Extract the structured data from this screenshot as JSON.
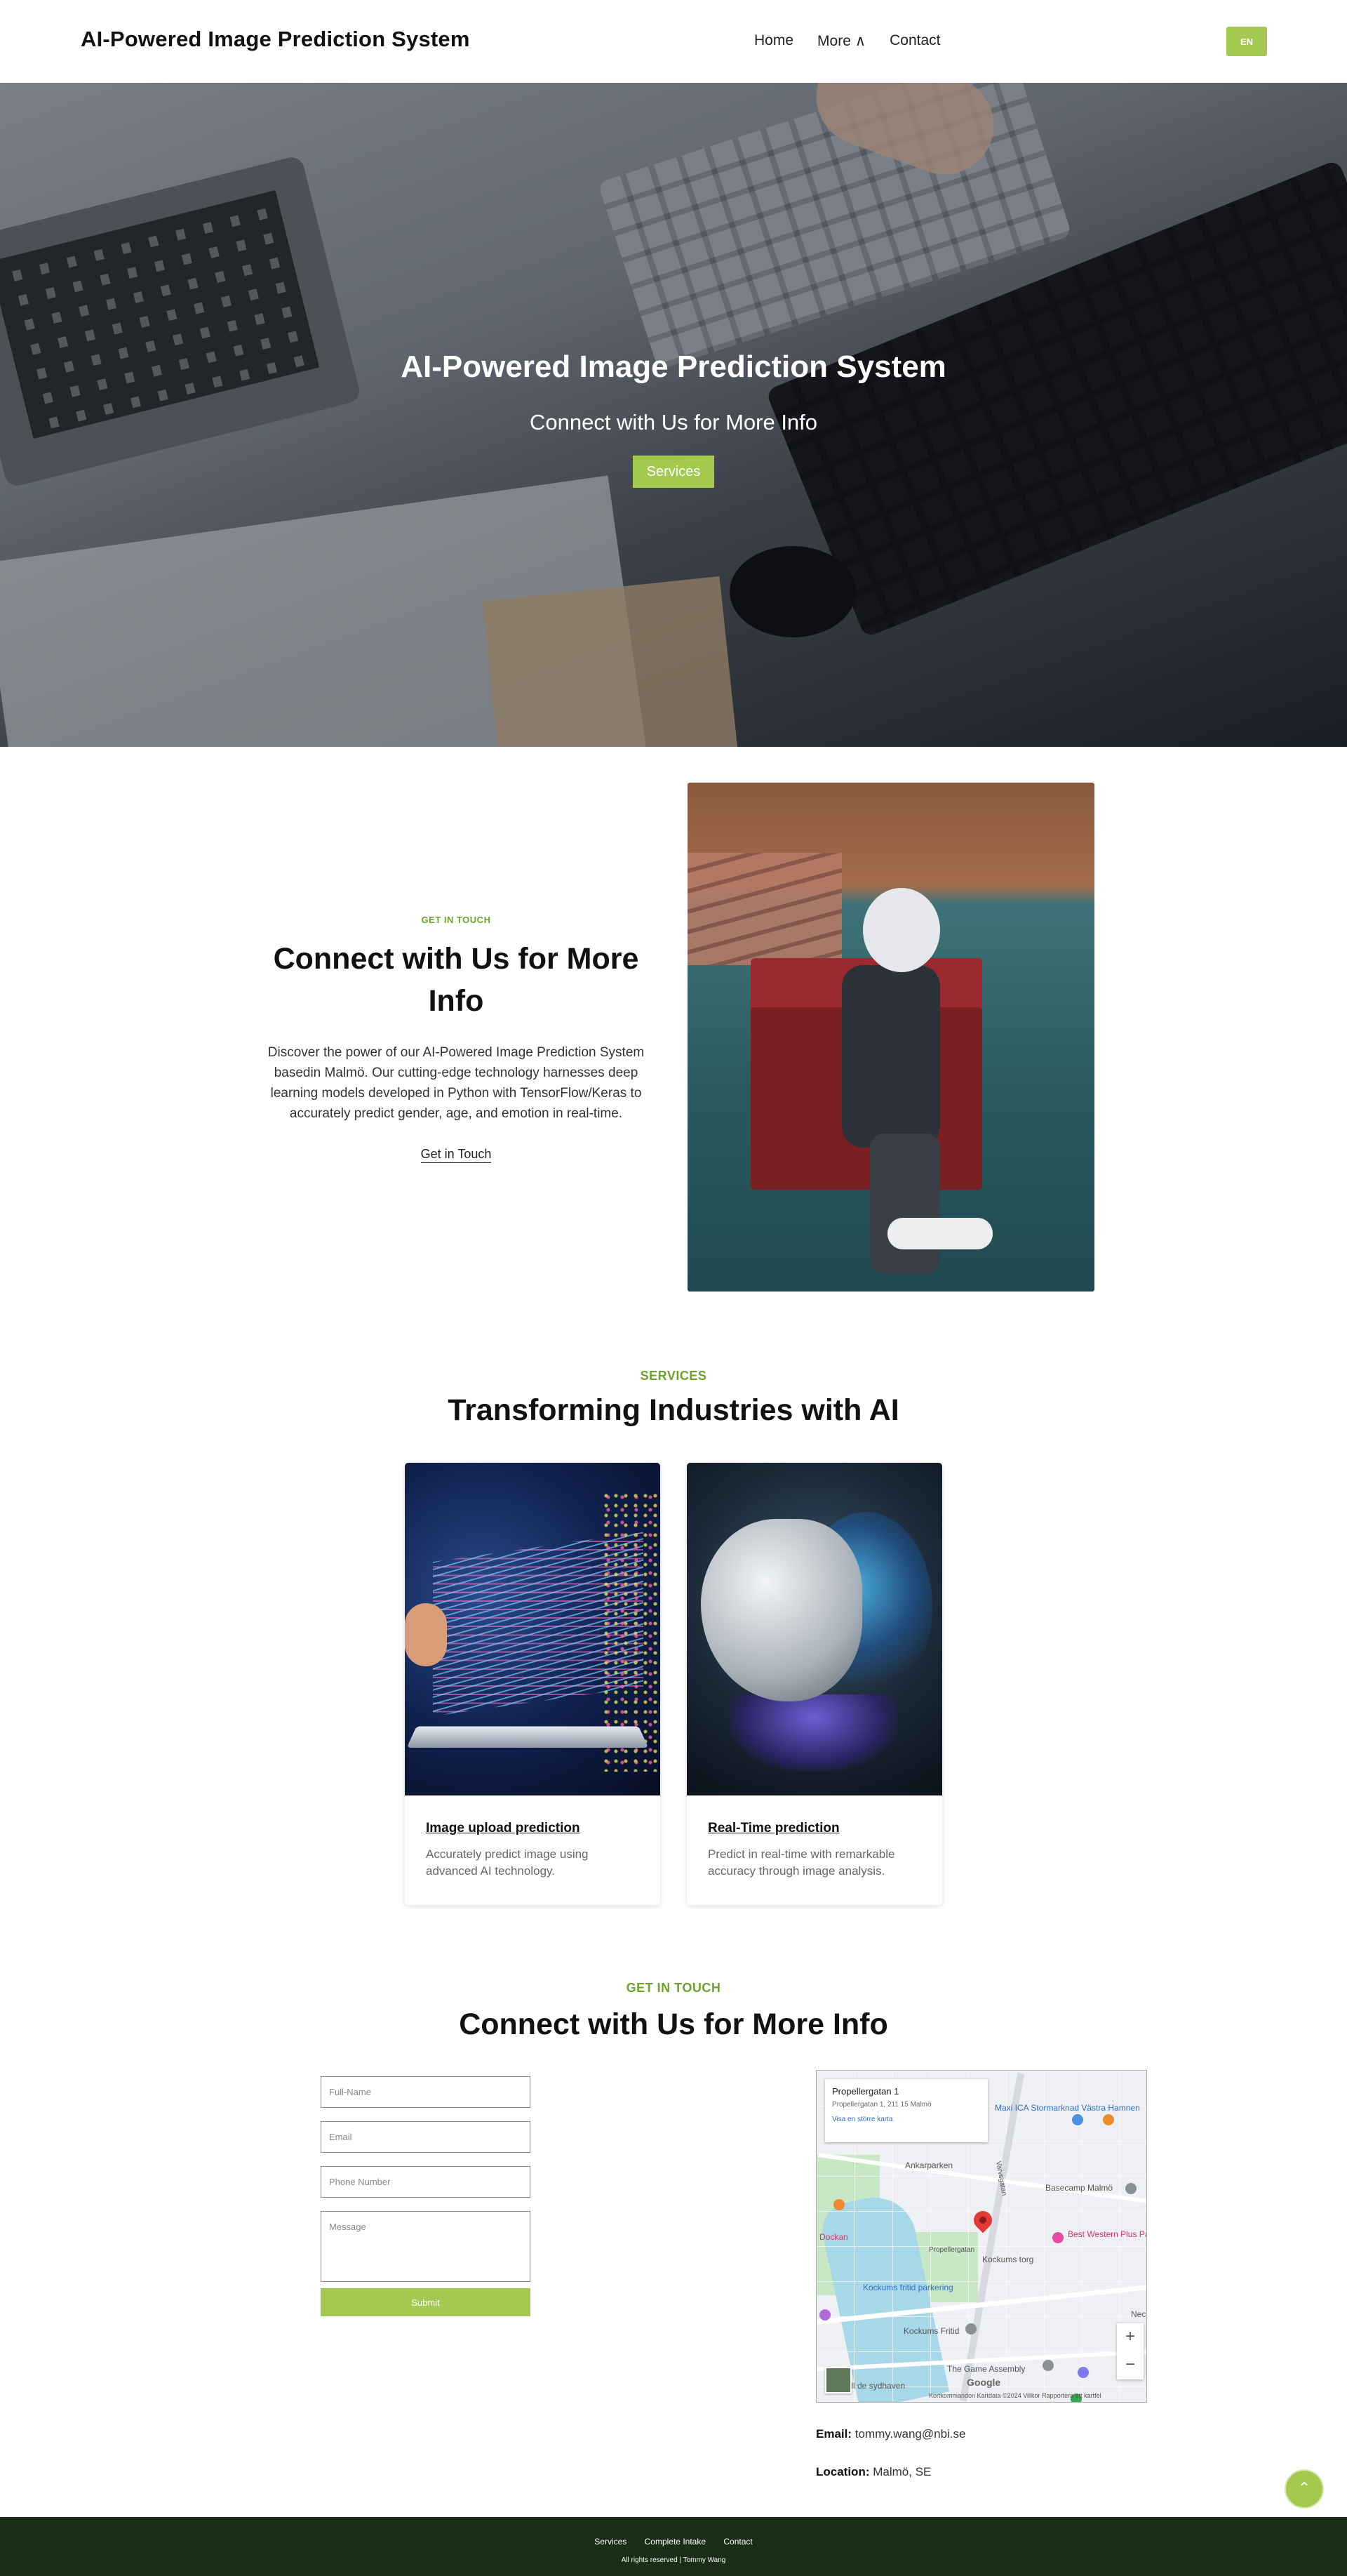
{
  "header": {
    "brand": "AI-Powered Image Prediction System",
    "nav": {
      "home": "Home",
      "more": "More ∧",
      "contact": "Contact"
    },
    "lang": "EN"
  },
  "hero": {
    "title": "AI-Powered Image Prediction System",
    "subtitle": "Connect with Us for More Info",
    "button": "Services"
  },
  "intro": {
    "tag": "GET IN TOUCH",
    "title": "Connect with Us for More Info",
    "text": "Discover the power of our AI-Powered Image Prediction System basedin Malmö. Our cutting-edge technology harnesses deep learning models developed in Python with TensorFlow/Keras to accurately predict gender, age, and emotion in real-time.",
    "link": "Get in Touch"
  },
  "services": {
    "tag": "SERVICES",
    "title": "Transforming Industries with AI",
    "cards": [
      {
        "title": "Image upload prediction",
        "desc": "Accurately predict image using advanced AI technology."
      },
      {
        "title": "Real-Time prediction",
        "desc": "Predict in real-time with remarkable accuracy through image analysis."
      }
    ]
  },
  "contact": {
    "tag": "GET IN TOUCH",
    "title": "Connect with Us for More Info",
    "form": {
      "name_placeholder": "Full-Name",
      "email_placeholder": "Email",
      "phone_placeholder": "Phone Number",
      "message_placeholder": "Message",
      "submit": "Submit"
    },
    "map": {
      "info_title": "Propellergatan 1",
      "info_address": "Propellergatan 1, 211 15 Malmö",
      "info_link": "Visa en större karta",
      "labels": {
        "ica": "Maxi ICA Stormarknad Västra Hamnen",
        "ankar": "Ankarparken",
        "basecamp": "Basecamp Malmö",
        "bestwestern": "Best Western Plus Park City Malmö",
        "kockums_torg": "Kockums torg",
        "fritid": "Kockums fritid parkering",
        "fritid2": "Kockums Fritid",
        "assembly": "The Game Assembly",
        "propeller": "Propellergatan",
        "varvs": "Varvsgatan",
        "dockan": "Dockan",
        "sydhav": "Gå till de sydhaven",
        "nec": "Nec"
      },
      "google": "Google",
      "footer": "Kortkommandon   Kartdata ©2024   Villkor   Rapportera ett kartfel",
      "zoom_in": "+",
      "zoom_out": "−"
    },
    "email_label": "Email:",
    "email_value": "tommy.wang@nbi.se",
    "location_label": "Location:",
    "location_value": "Malmö, SE"
  },
  "to_top": "⌃",
  "footer": {
    "links": [
      "Services",
      "Complete Intake",
      "Contact"
    ],
    "copyright": "All rights reserved | Tommy Wang"
  },
  "colors": {
    "accent": "#a3c94f",
    "tag": "#6aa52a",
    "footer": "#192d17"
  }
}
